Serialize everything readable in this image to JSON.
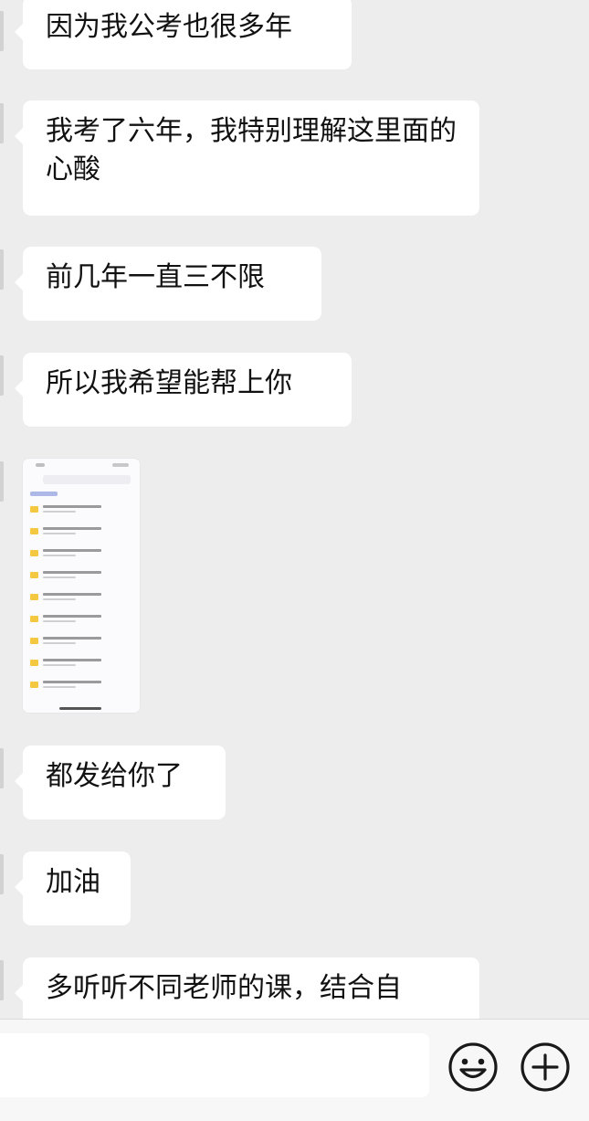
{
  "messages": [
    {
      "text": "因为我公考也很多年"
    },
    {
      "text": "我考了六年，我特别理解这里面的心酸"
    },
    {
      "text": "前几年一直三不限"
    },
    {
      "text": "所以我希望能帮上你"
    },
    {
      "type": "image-thumbnail"
    },
    {
      "text": "都发给你了"
    },
    {
      "text": "加油"
    },
    {
      "text": "多听听不同老师的课，结合自"
    }
  ],
  "composer": {
    "placeholder": "",
    "icons": [
      "emoji-icon",
      "plus-icon"
    ]
  },
  "colors": {
    "background": "#ededed",
    "bubble": "#ffffff",
    "bottom_bar": "#f7f7f7"
  }
}
